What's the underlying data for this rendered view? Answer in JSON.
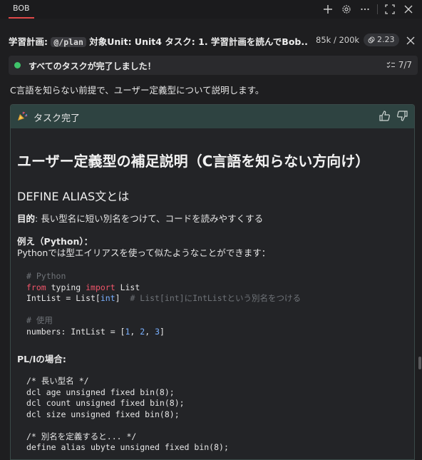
{
  "topbar": {
    "tab_label": "BOB"
  },
  "header": {
    "title_prefix": "学習計画: ",
    "title_pill": "@/plan",
    "title_suffix": " 対象Unit: Unit4 タスク: 1. 学習計画を読んでBob...",
    "tokens": "85k / 200k",
    "cost": "2.23"
  },
  "status": {
    "text": "すべてのタスクが完了しました！",
    "count": "7/7"
  },
  "intro": "C言語を知らない前提で、ユーザー定義型について説明します。",
  "card": {
    "title": "タスク完了",
    "h1": "ユーザー定義型の補足説明（C言語を知らない方向け）",
    "h2": "DEFINE ALIAS文とは",
    "purpose_label": "目的",
    "purpose_text": ": 長い型名に短い別名をつけて、コードを読みやすくする",
    "example_label": "例え（Python）",
    "example_colon": "：",
    "example_text": "Pythonでは型エイリアスを使って似たようなことができます：",
    "python_code": {
      "comment1": "# Python",
      "kw_from": "from",
      "mod": " typing ",
      "kw_import": "import",
      "name": " List",
      "alias_lhs": "IntList = List[",
      "alias_type": "int",
      "alias_rhs": "]",
      "alias_comment": "# List[int]にIntListという別名をつける",
      "comment2": "# 使用",
      "use_lhs": "numbers: IntList = [",
      "n1": "1",
      "n2": "2",
      "n3": "3",
      "use_rhs": "]"
    },
    "pli_label": "PL/Iの場合",
    "pli_colon": ":",
    "pli_code": [
      "/* 長い型名 */",
      "dcl age unsigned fixed bin(8);",
      "dcl count unsigned fixed bin(8);",
      "dcl size unsigned fixed bin(8);",
      "",
      "/* 別名を定義すると... */",
      "define alias ubyte unsigned fixed bin(8);"
    ]
  },
  "colors": {
    "accent": "#e04848",
    "status_dot": "#3fc36a",
    "card_header": "#2e4341",
    "keyword": "#f0556a",
    "number": "#79b0ff"
  }
}
